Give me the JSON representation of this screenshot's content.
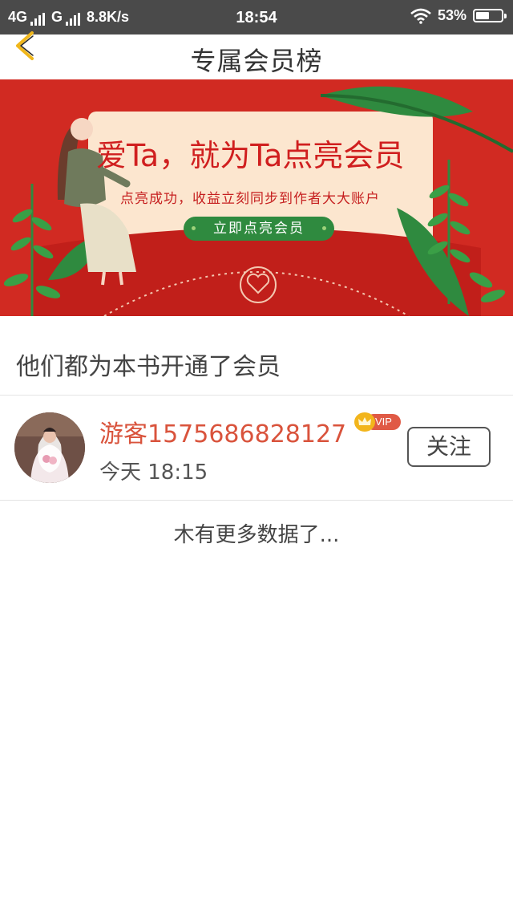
{
  "status_bar": {
    "network1": "4G",
    "network2": "G",
    "speed": "8.8K/s",
    "time": "18:54",
    "battery_text": "53%",
    "battery_level": 0.53,
    "icons": [
      "signal-icon",
      "wifi-icon",
      "battery-icon"
    ]
  },
  "header": {
    "title": "专属会员榜",
    "back_icon": "chevron-left-icon",
    "accent": "#f0b71b"
  },
  "banner": {
    "headline": "爱Ta，就为Ta点亮会员",
    "subtitle": "点亮成功，收益立刻同步到作者大大账户",
    "cta_label": "立即点亮会员",
    "bg_color": "#d12a22",
    "card_color": "#fce6cf",
    "cta_color": "#2f8a3f"
  },
  "section": {
    "title": "他们都为本书开通了会员"
  },
  "members": [
    {
      "name": "游客1575686828127",
      "badge": "VIP",
      "time": "今天 18:15",
      "follow_label": "关注",
      "name_color": "#d9533c"
    }
  ],
  "footer": {
    "no_more_text": "木有更多数据了..."
  }
}
